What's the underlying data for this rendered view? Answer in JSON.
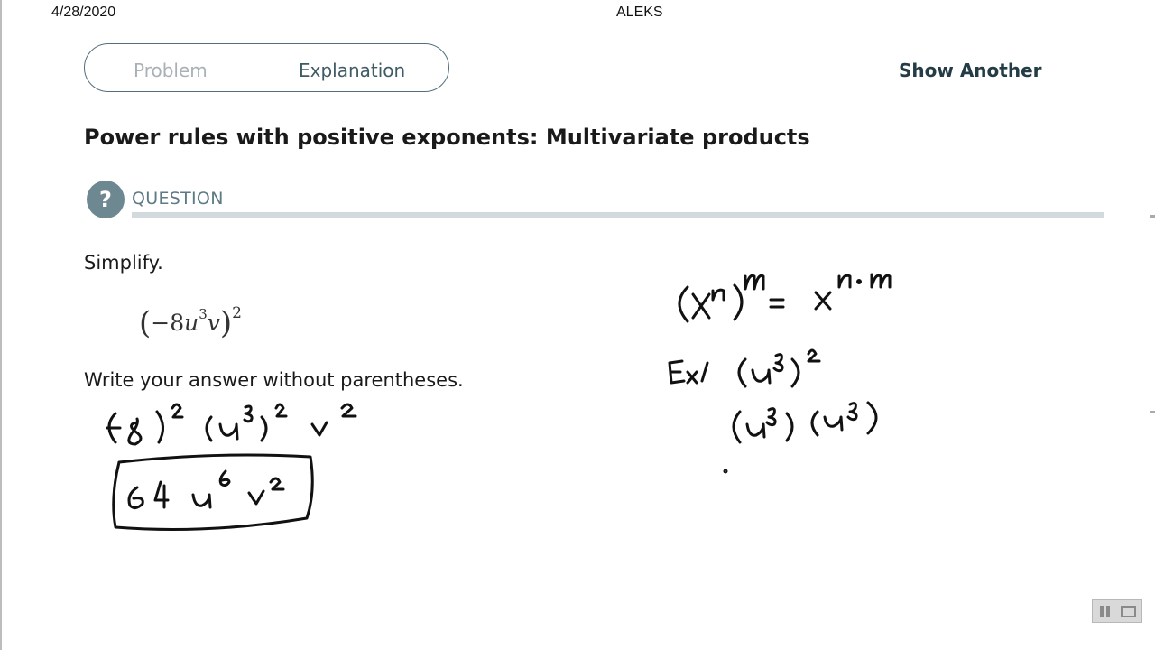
{
  "header": {
    "date": "4/28/2020",
    "site": "ALEKS"
  },
  "tabs": [
    {
      "label": "Problem",
      "active": false
    },
    {
      "label": "Explanation",
      "active": true
    }
  ],
  "actions": {
    "show_another": "Show Another"
  },
  "page_title": "Power rules with positive exponents: Multivariate products",
  "question": {
    "icon": "question-icon",
    "label": "QUESTION",
    "prompt": "Simplify.",
    "expression": {
      "coef": "−8",
      "var1": "u",
      "exp1": "3",
      "var2": "v",
      "outer_exp": "2"
    },
    "instruction": "Write your answer without parentheses."
  },
  "handwriting": {
    "step1": "(−8)² (u³)² v²",
    "answer": "64 u⁶ v²",
    "rule": "(xⁿ)ᵐ = xⁿ·ᵐ",
    "example": "Ex) (u³)²",
    "example_expanded": "(u³)(u³)"
  },
  "video_controls": {
    "pause": "pause-icon",
    "screen": "screen-icon"
  },
  "colors": {
    "accent": "#52707c",
    "title": "#1a1a1a",
    "question": "#5d7a85",
    "rule": "#d3dadd"
  }
}
